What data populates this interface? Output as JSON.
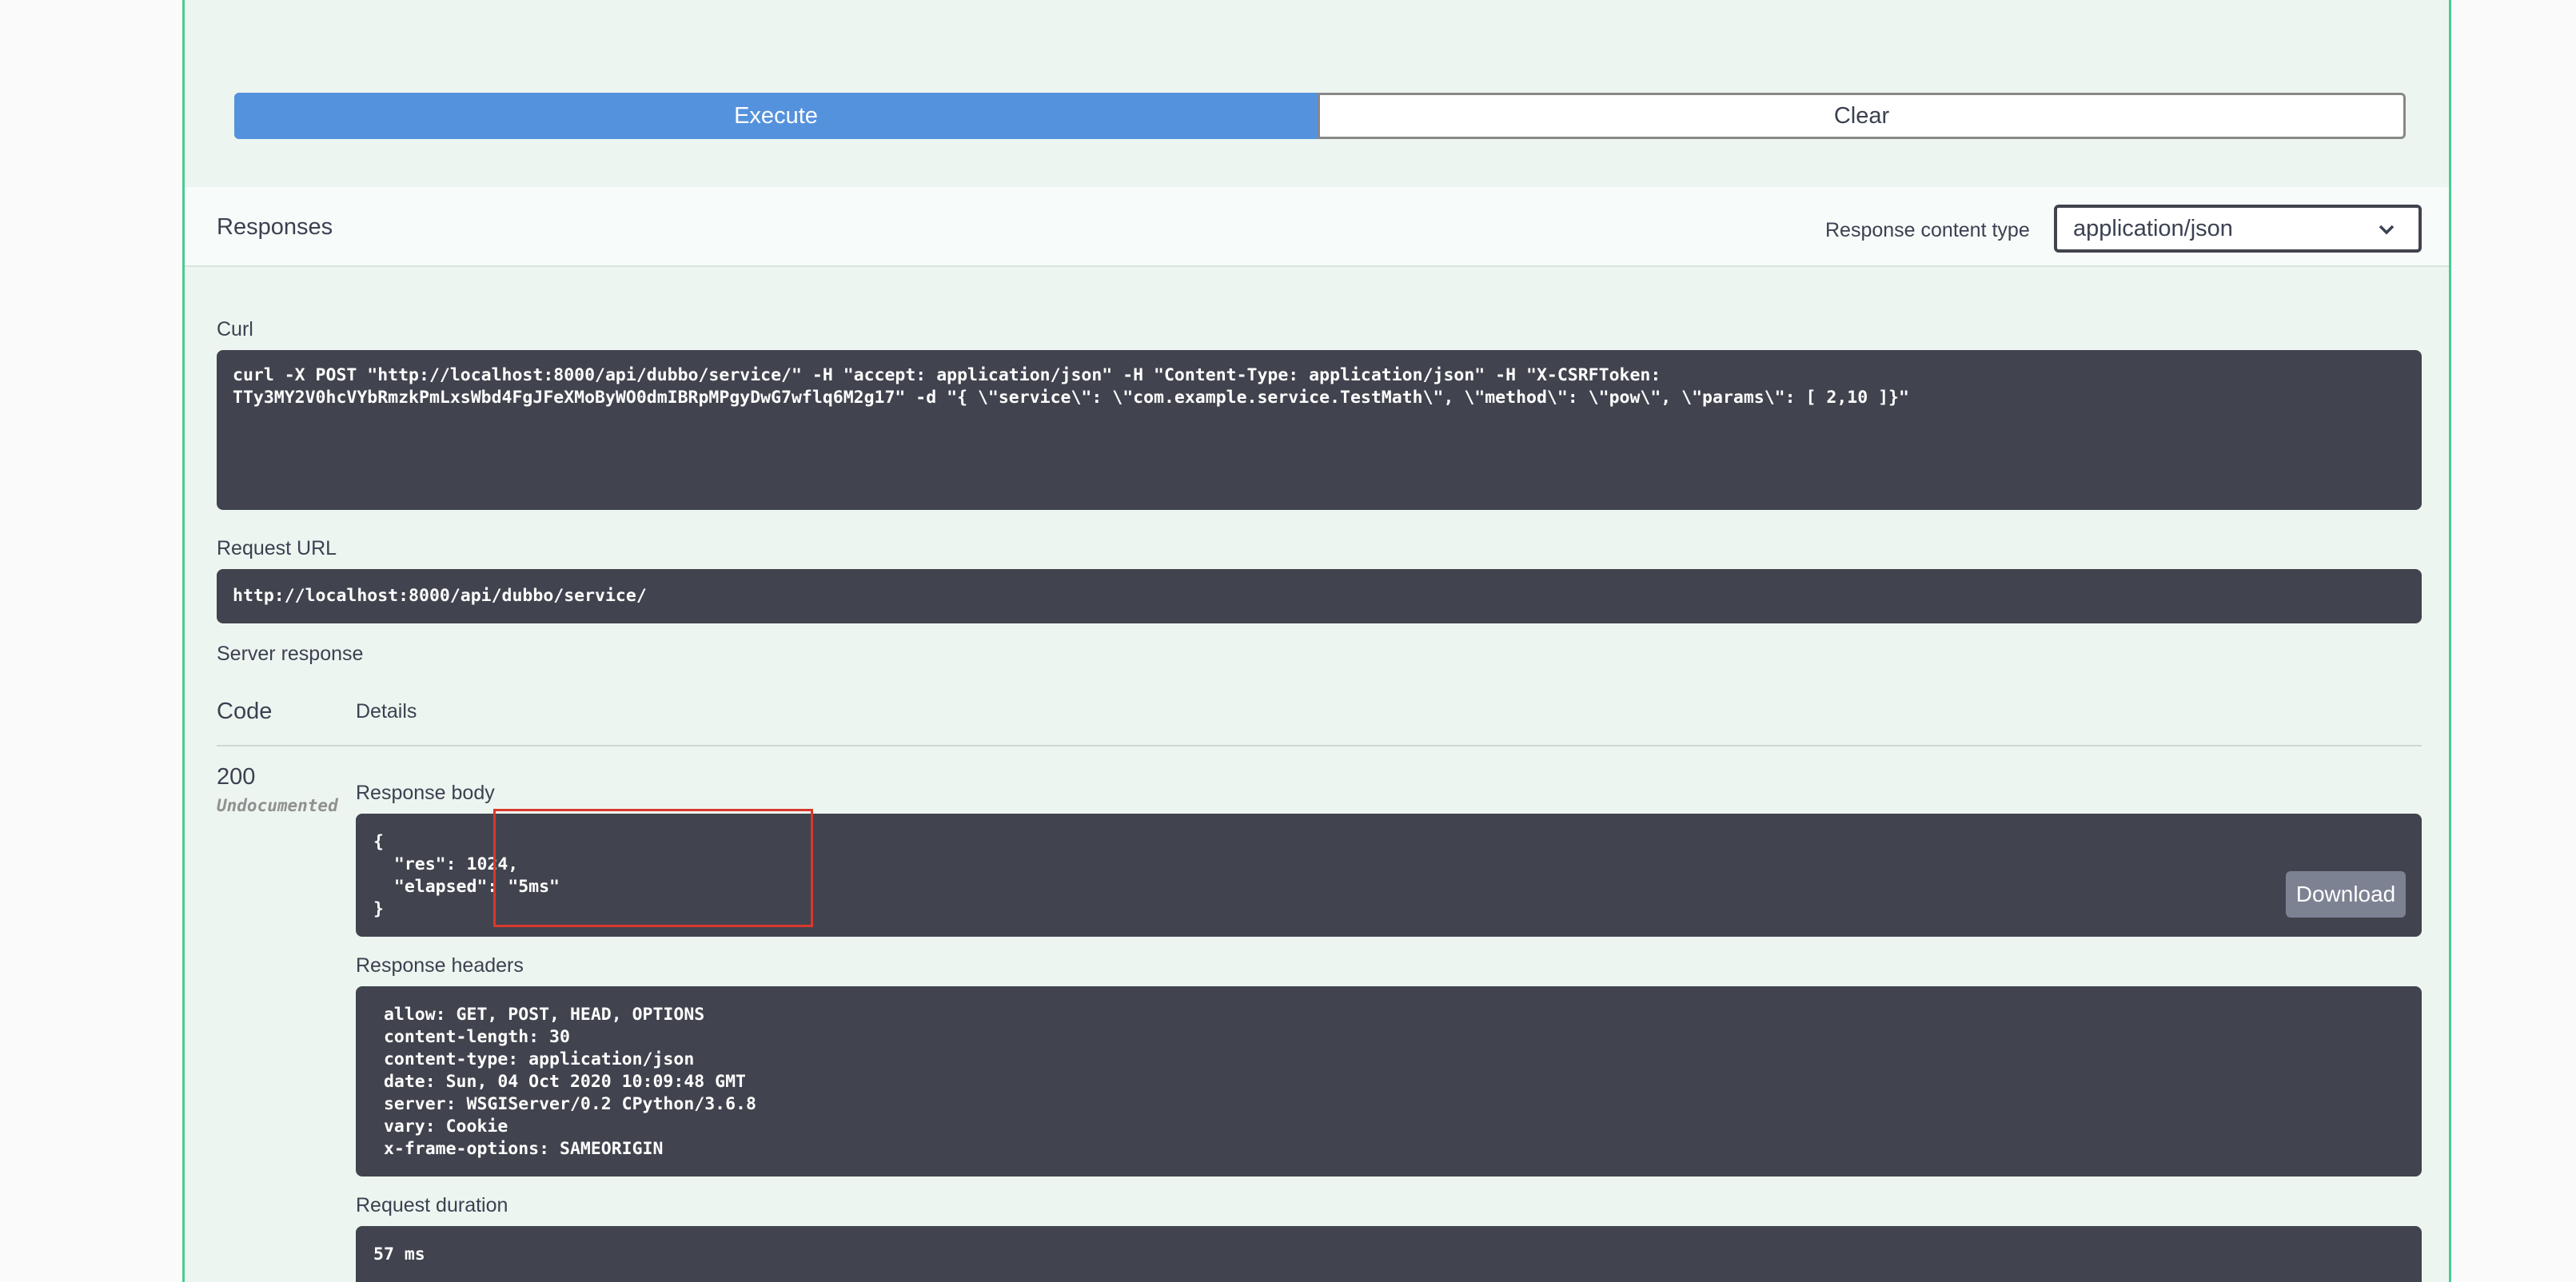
{
  "buttons": {
    "execute": "Execute",
    "clear": "Clear"
  },
  "responses": {
    "title": "Responses",
    "content_type_label": "Response content type",
    "content_type_value": "application/json"
  },
  "curl": {
    "label": "Curl",
    "command": "curl -X POST \"http://localhost:8000/api/dubbo/service/\" -H \"accept: application/json\" -H \"Content-Type: application/json\" -H \"X-CSRFToken: \nTTy3MY2V0hcVYbRmzkPmLxsWbd4FgJFeXMoByWO0dmIBRpMPgyDwG7wflq6M2g17\" -d \"{ \\\"service\\\": \\\"com.example.service.TestMath\\\", \\\"method\\\": \\\"pow\\\", \\\"params\\\": [ 2,10 ]}\""
  },
  "request_url": {
    "label": "Request URL",
    "value": "http://localhost:8000/api/dubbo/service/"
  },
  "server_response": {
    "label": "Server response",
    "code_header": "Code",
    "details_header": "Details",
    "code": "200",
    "undocumented": "Undocumented",
    "body_label": "Response body",
    "body": "{\n  \"res\": 1024,\n  \"elapsed\": \"5ms\"\n}",
    "download": "Download",
    "headers_label": "Response headers",
    "headers": " allow: GET, POST, HEAD, OPTIONS \n content-length: 30 \n content-type: application/json \n date: Sun, 04 Oct 2020 10:09:48 GMT \n server: WSGIServer/0.2 CPython/3.6.8 \n vary: Cookie \n x-frame-options: SAMEORIGIN ",
    "duration_label": "Request duration",
    "duration": "57 ms"
  },
  "colors": {
    "execute": "#5592dd",
    "panel_border": "#49cc90",
    "code_bg": "#41444e",
    "highlight": "#d9382c"
  }
}
